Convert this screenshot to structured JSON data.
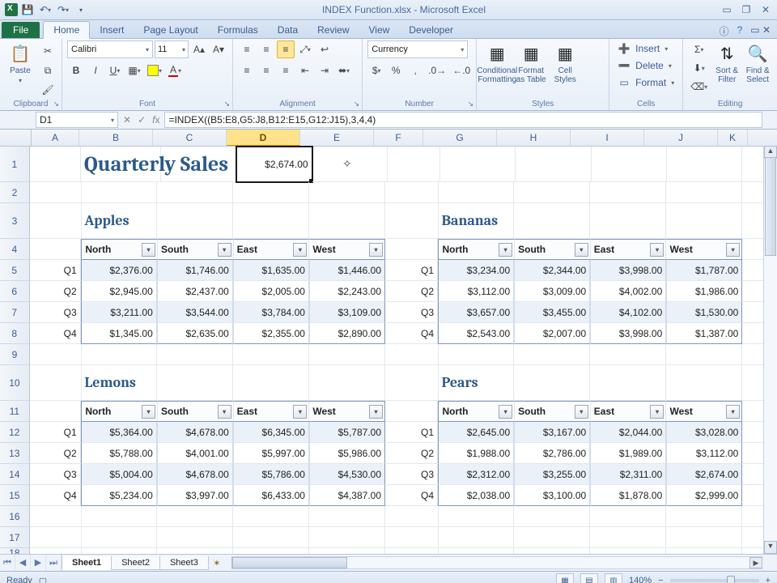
{
  "title": "INDEX Function.xlsx - Microsoft Excel",
  "tabs": {
    "file": "File",
    "home": "Home",
    "insert": "Insert",
    "pagelayout": "Page Layout",
    "formulas": "Formulas",
    "data": "Data",
    "review": "Review",
    "view": "View",
    "developer": "Developer"
  },
  "ribbon": {
    "clipboard": {
      "label": "Clipboard",
      "paste": "Paste"
    },
    "font": {
      "label": "Font",
      "name": "Calibri",
      "size": "11"
    },
    "alignment": {
      "label": "Alignment"
    },
    "number": {
      "label": "Number",
      "format": "Currency"
    },
    "styles": {
      "label": "Styles",
      "cond": "Conditional\nFormatting",
      "fmtTable": "Format\nas Table",
      "cellStyles": "Cell\nStyles"
    },
    "cells": {
      "label": "Cells",
      "insert": "Insert",
      "delete": "Delete",
      "format": "Format"
    },
    "editing": {
      "label": "Editing",
      "sort": "Sort &\nFilter",
      "find": "Find &\nSelect"
    }
  },
  "namebox": "D1",
  "formula": "=INDEX((B5:E8,G5:J8,B12:E15,G12:J15),3,4,4)",
  "cols": [
    "A",
    "B",
    "C",
    "D",
    "E",
    "F",
    "G",
    "H",
    "I",
    "J",
    "K"
  ],
  "rowlabels": [
    "1",
    "2",
    "3",
    "4",
    "5",
    "6",
    "7",
    "8",
    "9",
    "10",
    "11",
    "12",
    "13",
    "14",
    "15",
    "16",
    "17",
    "18"
  ],
  "bigTitle": "Quarterly Sales",
  "d1": "$2,674.00",
  "fruits": {
    "apples": "Apples",
    "bananas": "Bananas",
    "lemons": "Lemons",
    "pears": "Pears"
  },
  "regions": [
    "North",
    "South",
    "East",
    "West"
  ],
  "quarters": [
    "Q1",
    "Q2",
    "Q3",
    "Q4"
  ],
  "tables": {
    "apples": [
      [
        "$2,376.00",
        "$1,746.00",
        "$1,635.00",
        "$1,446.00"
      ],
      [
        "$2,945.00",
        "$2,437.00",
        "$2,005.00",
        "$2,243.00"
      ],
      [
        "$3,211.00",
        "$3,544.00",
        "$3,784.00",
        "$3,109.00"
      ],
      [
        "$1,345.00",
        "$2,635.00",
        "$2,355.00",
        "$2,890.00"
      ]
    ],
    "bananas": [
      [
        "$3,234.00",
        "$2,344.00",
        "$3,998.00",
        "$1,787.00"
      ],
      [
        "$3,112.00",
        "$3,009.00",
        "$4,002.00",
        "$1,986.00"
      ],
      [
        "$3,657.00",
        "$3,455.00",
        "$4,102.00",
        "$1,530.00"
      ],
      [
        "$2,543.00",
        "$2,007.00",
        "$3,998.00",
        "$1,387.00"
      ]
    ],
    "lemons": [
      [
        "$5,364.00",
        "$4,678.00",
        "$6,345.00",
        "$5,787.00"
      ],
      [
        "$5,788.00",
        "$4,001.00",
        "$5,997.00",
        "$5,986.00"
      ],
      [
        "$5,004.00",
        "$4,678.00",
        "$5,786.00",
        "$4,530.00"
      ],
      [
        "$5,234.00",
        "$3,997.00",
        "$6,433.00",
        "$4,387.00"
      ]
    ],
    "pears": [
      [
        "$2,645.00",
        "$3,167.00",
        "$2,044.00",
        "$3,028.00"
      ],
      [
        "$1,988.00",
        "$2,786.00",
        "$1,989.00",
        "$3,112.00"
      ],
      [
        "$2,312.00",
        "$3,255.00",
        "$2,311.00",
        "$2,674.00"
      ],
      [
        "$2,038.00",
        "$3,100.00",
        "$1,878.00",
        "$2,999.00"
      ]
    ]
  },
  "sheets": [
    "Sheet1",
    "Sheet2",
    "Sheet3"
  ],
  "status": {
    "ready": "Ready",
    "zoom": "140%"
  }
}
